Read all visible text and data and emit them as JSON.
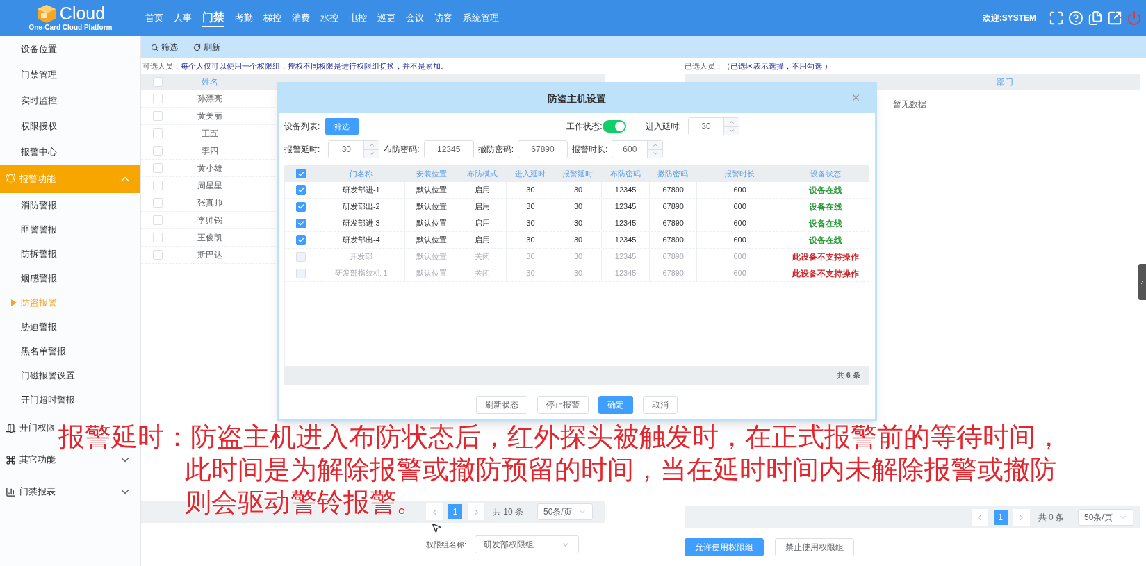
{
  "header": {
    "logo_text": "Cloud",
    "logo_subtitle": "One-Card Cloud Platform",
    "welcome": "欢迎:SYSTEM",
    "nav": [
      {
        "label": "首页",
        "selected": false
      },
      {
        "label": "人事",
        "selected": false
      },
      {
        "label": "门禁",
        "selected": true
      },
      {
        "label": "考勤",
        "selected": false
      },
      {
        "label": "梯控",
        "selected": false
      },
      {
        "label": "消费",
        "selected": false
      },
      {
        "label": "水控",
        "selected": false
      },
      {
        "label": "电控",
        "selected": false
      },
      {
        "label": "巡更",
        "selected": false
      },
      {
        "label": "会议",
        "selected": false
      },
      {
        "label": "访客",
        "selected": false
      },
      {
        "label": "系统管理",
        "selected": false
      }
    ]
  },
  "sidebar": {
    "items": [
      {
        "kind": "item",
        "label": "设备位置",
        "selected": false
      },
      {
        "kind": "item",
        "label": "门禁管理",
        "selected": false
      },
      {
        "kind": "item",
        "label": "实时监控",
        "selected": false
      },
      {
        "kind": "item",
        "label": "权限授权",
        "selected": false
      },
      {
        "kind": "item",
        "label": "报警中心",
        "selected": false
      },
      {
        "kind": "group",
        "label": "报警功能",
        "selected": true,
        "expanded": true,
        "children": [
          {
            "label": "消防警报",
            "selected": false
          },
          {
            "label": "匪警警报",
            "selected": false
          },
          {
            "label": "防拆警报",
            "selected": false
          },
          {
            "label": "烟感警报",
            "selected": false
          },
          {
            "label": "防盗报警",
            "selected": true
          },
          {
            "label": "胁迫警报",
            "selected": false
          },
          {
            "label": "黑名单警报",
            "selected": false
          },
          {
            "label": "门磁报警设置",
            "selected": false
          },
          {
            "label": "开门超时警报",
            "selected": false
          }
        ]
      },
      {
        "kind": "group",
        "label": "开门权限",
        "selected": false
      },
      {
        "kind": "group",
        "label": "其它功能",
        "selected": false,
        "expanded": false
      },
      {
        "kind": "group",
        "label": "门禁报表",
        "selected": false,
        "expanded": false
      }
    ]
  },
  "toolbar": [
    "筛选",
    "刷新"
  ],
  "left_panel": {
    "note_label": "可选人员：",
    "note": "每个人仅可以使用一个权限组，授权不同权限是进行权限组切换，并不是累加。",
    "all_checked": false,
    "columns": [
      "姓名"
    ],
    "rows": [
      {
        "name": "孙漂亮",
        "checked": false
      },
      {
        "name": "黄美丽",
        "checked": false
      },
      {
        "name": "王五",
        "checked": false
      },
      {
        "name": "李四",
        "checked": false
      },
      {
        "name": "黄小雄",
        "checked": false
      },
      {
        "name": "周星星",
        "checked": false
      },
      {
        "name": "张真帅",
        "checked": false
      },
      {
        "name": "李帅锅",
        "checked": false
      },
      {
        "name": "王俊凯",
        "checked": false
      },
      {
        "name": "斯巴达",
        "checked": false
      }
    ],
    "pagination": {
      "page": "1",
      "total": "共 10 条",
      "page_size": "50条/页"
    },
    "group_field": {
      "label": "权限组名称:",
      "value": "研发部权限组"
    }
  },
  "right_panel": {
    "note_label": "已选人员：",
    "note": "（已选区表示选择，不用勾选 ）",
    "columns": [
      "部门"
    ],
    "empty": "暂无数据",
    "pagination": {
      "page": "1",
      "total": "共 0 条",
      "page_size": "50条/页"
    },
    "buttons": [
      {
        "label": "允许使用权限组",
        "kind": "primary"
      },
      {
        "label": "禁止使用权限组",
        "kind": "default"
      }
    ]
  },
  "modal": {
    "title": "防盗主机设置",
    "device_list_label": "设备列表:",
    "filter_button": "筛选",
    "work_status": {
      "label": "工作状态:",
      "on": true
    },
    "entry_delay": {
      "label": "进入延时:",
      "value": "30",
      "kind": "spinner"
    },
    "fields": [
      {
        "label": "报警延时:",
        "value": "30",
        "kind": "spinner"
      },
      {
        "label": "布防密码:",
        "value": "12345",
        "kind": "text"
      },
      {
        "label": "撤防密码:",
        "value": "67890",
        "kind": "text"
      },
      {
        "label": "报警时长:",
        "value": "600",
        "kind": "spinner"
      }
    ],
    "all_checked": true,
    "columns": [
      "门名称",
      "安装位置",
      "布防模式",
      "进入延时",
      "报警延时",
      "布防密码",
      "撤防密码",
      "报警时长",
      "设备状态"
    ],
    "rows": [
      {
        "checked": true,
        "disabled": false,
        "cells": [
          "研发部进-1",
          "默认位置",
          "启用",
          "30",
          "30",
          "12345",
          "67890",
          "600"
        ],
        "status": "设备在线",
        "color": "#2e9c3b"
      },
      {
        "checked": true,
        "disabled": false,
        "cells": [
          "研发部出-2",
          "默认位置",
          "启用",
          "30",
          "30",
          "12345",
          "67890",
          "600"
        ],
        "status": "设备在线",
        "color": "#2e9c3b"
      },
      {
        "checked": true,
        "disabled": false,
        "cells": [
          "研发部进-3",
          "默认位置",
          "启用",
          "30",
          "30",
          "12345",
          "67890",
          "600"
        ],
        "status": "设备在线",
        "color": "#2e9c3b"
      },
      {
        "checked": true,
        "disabled": false,
        "cells": [
          "研发部出-4",
          "默认位置",
          "启用",
          "30",
          "30",
          "12345",
          "67890",
          "600"
        ],
        "status": "设备在线",
        "color": "#2e9c3b"
      },
      {
        "checked": false,
        "disabled": true,
        "cells": [
          "开发部",
          "默认位置",
          "关闭",
          "30",
          "30",
          "12345",
          "67890",
          "600"
        ],
        "status": "此设备不支持操作",
        "color": "#d0262b"
      },
      {
        "checked": false,
        "disabled": true,
        "cells": [
          "研发部指纹机-1",
          "默认位置",
          "关闭",
          "30",
          "30",
          "12345",
          "67890",
          "600"
        ],
        "status": "此设备不支持操作",
        "color": "#d0262b"
      }
    ],
    "total": "共 6 条",
    "buttons": [
      {
        "label": "刷新状态",
        "kind": "default"
      },
      {
        "label": "停止报警",
        "kind": "default"
      },
      {
        "label": "确定",
        "kind": "primary"
      },
      {
        "label": "取消",
        "kind": "default"
      }
    ]
  },
  "caption": [
    "报警延时：防盗主机进入布防状态后，红外探头被触发时，在正式报警前的等待时间，",
    "此时间是为解除报警或撤防预留的时间，当在延时时间内未解除报警或撤防",
    "则会驱动警铃报警。"
  ]
}
